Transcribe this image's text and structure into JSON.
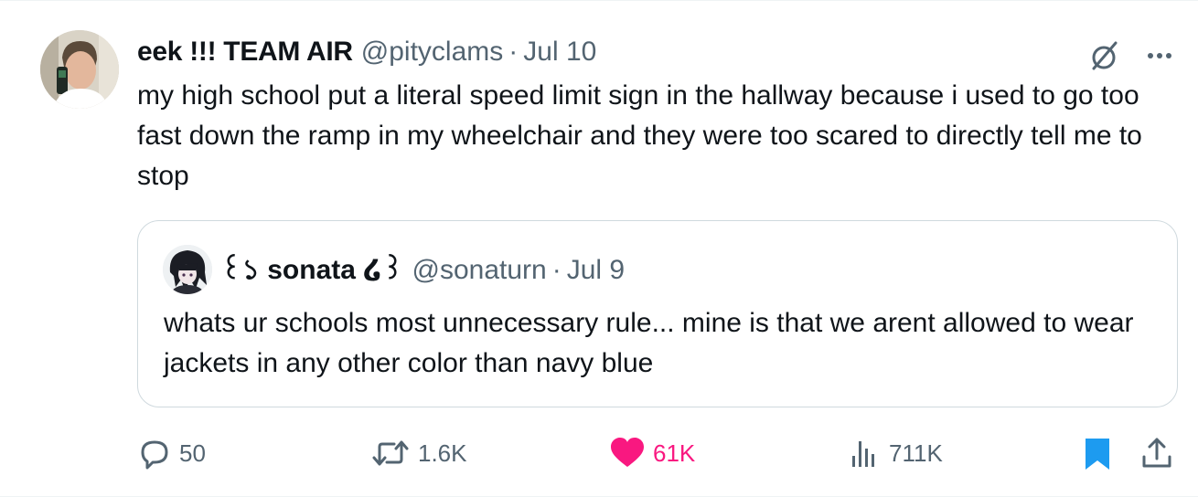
{
  "tweet": {
    "author": {
      "display_name": "eek !!! TEAM AIR",
      "handle": "@pityclams",
      "separator": "·",
      "date": "Jul 10"
    },
    "text": "my high school put a literal speed limit sign in the hallway because i used to go too fast down the ramp in my wheelchair and they were too scared to directly tell me to stop",
    "quote": {
      "author": {
        "display_name": "꒰১ sonata ໒꒱",
        "handle": "@sonaturn",
        "separator": "·",
        "date": "Jul 9"
      },
      "text": "whats ur schools most unnecessary rule... mine is that we arent allowed to wear jackets in any other color than navy blue"
    },
    "actions": {
      "replies": "50",
      "reposts": "1.6K",
      "likes": "61K",
      "views": "711K"
    },
    "icons": {
      "grok": "grok-icon",
      "more": "more-dots-icon",
      "reply": "reply-bubble-icon",
      "repost": "repost-arrows-icon",
      "like": "heart-icon",
      "views": "bar-chart-icon",
      "bookmark": "bookmark-icon",
      "share": "share-icon"
    },
    "colors": {
      "like_active": "#f91880",
      "bookmark_active": "#1d9bf0",
      "secondary_text": "#536471",
      "primary_text": "#0f1419"
    }
  }
}
